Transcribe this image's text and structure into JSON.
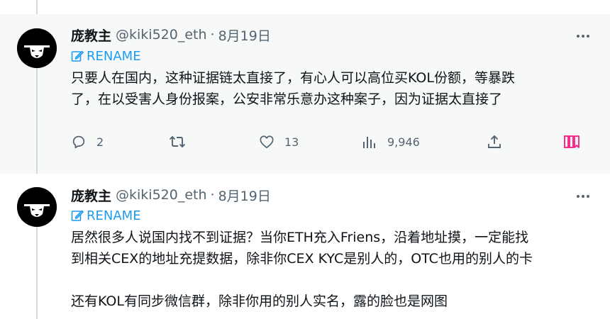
{
  "tweets": [
    {
      "display_name": "庞教主",
      "handle": "@kiki520_eth",
      "separator": "·",
      "date": "8月19日",
      "rename_label": "RENAME",
      "text": "只要人在国内，这种证据链太直接了，有心人可以高位买KOL份额，等暴跌\n了，在以受害人身份报案，公安非常乐意办这种案子，因为证据太直接了",
      "actions": {
        "replies": "2",
        "retweets": "",
        "likes": "13",
        "views": "9,946"
      }
    },
    {
      "display_name": "庞教主",
      "handle": "@kiki520_eth",
      "separator": "·",
      "date": "8月19日",
      "rename_label": "RENAME",
      "text": "居然很多人说国内找不到证据？当你ETH充入Friens，沿着地址摸，一定能找\n到相关CEX的地址充提数据，除非你CEX KYC是别人的，OTC也用的别人的卡\n\n还有KOL有同步微信群，除非你用的别人实名，露的脸也是网图"
    }
  ],
  "colors": {
    "accent": "#1d9bf0",
    "secondary_text": "#536471",
    "highlight_bg": "#f7f9f9",
    "thread_line": "#cfd9de",
    "bookmark_pink": "#f91880"
  },
  "icons": [
    "more-icon",
    "edit-icon",
    "reply-icon",
    "retweet-icon",
    "like-icon",
    "views-icon",
    "share-icon",
    "bookmark-icon"
  ]
}
